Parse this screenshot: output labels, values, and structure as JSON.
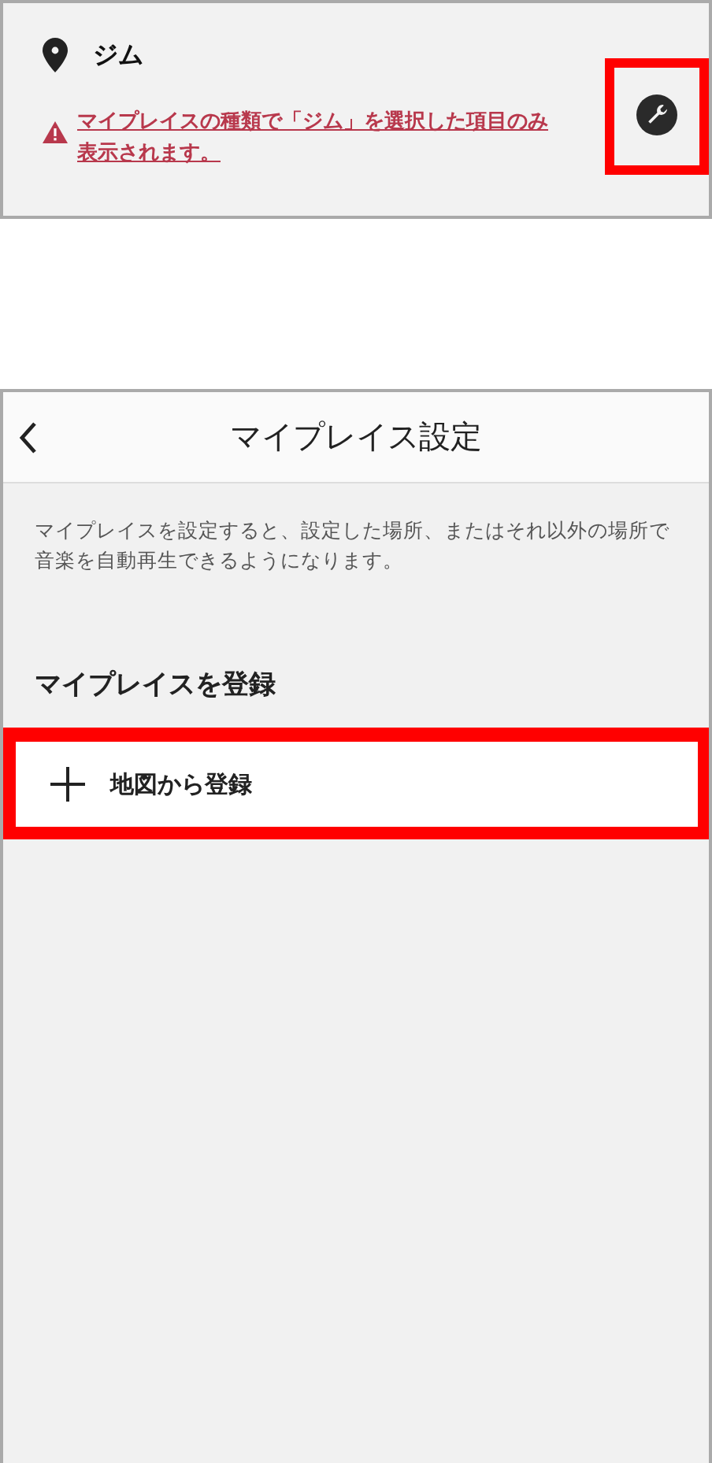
{
  "place_card": {
    "name": "ジム",
    "warning": "マイプレイスの種類で「ジム」を選択した項目のみ表示されます。",
    "settings_highlighted": true
  },
  "screen": {
    "title": "マイプレイス設定",
    "description": "マイプレイスを設定すると、設定した場所、またはそれ以外の場所で音楽を自動再生できるようになります。",
    "section_title": "マイプレイスを登録",
    "actions": [
      {
        "label": "地図から登録",
        "highlighted": true
      }
    ]
  }
}
